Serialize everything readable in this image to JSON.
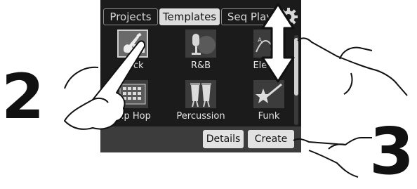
{
  "tabs": [
    {
      "label": "Projects",
      "active": false
    },
    {
      "label": "Templates",
      "active": true
    },
    {
      "label": "Seq Play",
      "active": false
    }
  ],
  "icons": {
    "settings": "gear-icon"
  },
  "templates": [
    {
      "label": "Rock",
      "icon": "electric-guitar-icon",
      "selected": true
    },
    {
      "label": "R&B",
      "icon": "microphone-icon",
      "selected": false
    },
    {
      "label": "Electro",
      "icon": "synth-icon",
      "selected": false
    },
    {
      "label": "Hip Hop",
      "icon": "drum-machine-icon",
      "selected": false
    },
    {
      "label": "Percussion",
      "icon": "conga-icon",
      "selected": false
    },
    {
      "label": "Funk",
      "icon": "guitar-star-icon",
      "selected": false
    }
  ],
  "buttons": {
    "details": "Details",
    "create": "Create"
  },
  "annotations": {
    "step_select": "2",
    "step_create": "3"
  },
  "colors": {
    "screen_bg": "#1b1b1b",
    "active_tab": "#dcdcdc",
    "bottom_bar": "#3c3c3c"
  }
}
